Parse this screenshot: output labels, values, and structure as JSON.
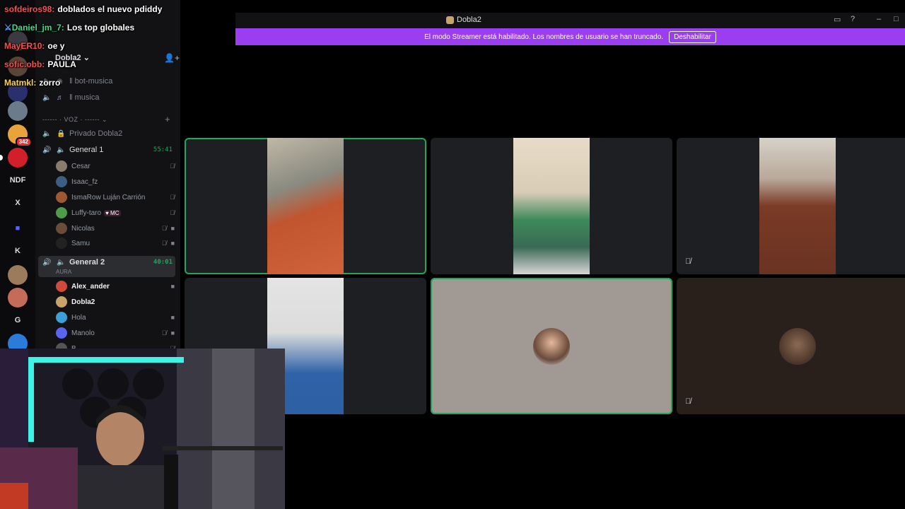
{
  "window": {
    "title": "Dobla2"
  },
  "banner": {
    "text": "El modo Streamer está habilitado. Los nombres de usuario se han truncado.",
    "button": "Deshabilitar"
  },
  "server": {
    "name": "Dobla2"
  },
  "rail": [
    "NDF",
    "X",
    "K",
    "G"
  ],
  "rail_badge": "342",
  "text_channels": [
    "bot-musica",
    "musica"
  ],
  "voice_category": "------ · VOZ · ------",
  "voice_channels": {
    "private": "Privado Dobla2",
    "general1": {
      "name": "General 1",
      "time": "55:41"
    },
    "general2": {
      "name": "General 2",
      "time": "40:01",
      "status": "AURA"
    }
  },
  "general1_users": [
    "Cesar",
    "Isaac_fz",
    "IsmaRow Luján Carrión",
    "Luffy-taro",
    "Nicolas",
    "Samu"
  ],
  "general1_tag": "MC",
  "general2_users": [
    "Alex_ander",
    "Dobla2",
    "Hola",
    "Manolo",
    "B"
  ],
  "chat": [
    {
      "user": "sofdeiros98:",
      "msg": "doblados el nuevo pdiddy",
      "color": "#ff4d4d"
    },
    {
      "user": "Daniel_jm_7:",
      "msg": "Los top globales",
      "color": "#3ddc84"
    },
    {
      "user": "MayER10:",
      "msg": "oe y",
      "color": "#ff4d4d"
    },
    {
      "user": "sofic.obb:",
      "msg": "PAULA",
      "color": "#ff4d4d"
    },
    {
      "user": "Matmkl:",
      "msg": "zorro",
      "color": "#ffd54a"
    }
  ],
  "colors": {
    "accent": "#9b3ef1",
    "speaking": "#23a55a",
    "bg": "#000000"
  },
  "icons": [
    "speaker-icon",
    "music-icon",
    "lock-icon",
    "mic-muted-icon",
    "camera-icon",
    "add-user-icon",
    "inbox-icon",
    "help-icon",
    "minimize-icon",
    "maximize-icon"
  ]
}
